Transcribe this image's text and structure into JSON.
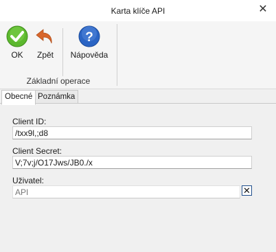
{
  "window": {
    "title": "Karta klíče API"
  },
  "toolbar": {
    "ok_label": "OK",
    "back_label": "Zpět",
    "help_label": "Nápověda",
    "group_label": "Základní operace"
  },
  "tabs": [
    {
      "label": "Obecné",
      "active": true
    },
    {
      "label": "Poznámka",
      "active": false
    }
  ],
  "form": {
    "client_id": {
      "label": "Client ID:",
      "value": "/txx9l,;d8"
    },
    "client_secret": {
      "label": "Client Secret:",
      "value": "V;7v;j/O17Jws/JB0./x"
    },
    "user": {
      "label": "Uživatel:",
      "value": "API"
    }
  },
  "colors": {
    "ok_green": "#5cb82e",
    "back_orange": "#d8662c",
    "help_blue": "#2a64c4"
  }
}
